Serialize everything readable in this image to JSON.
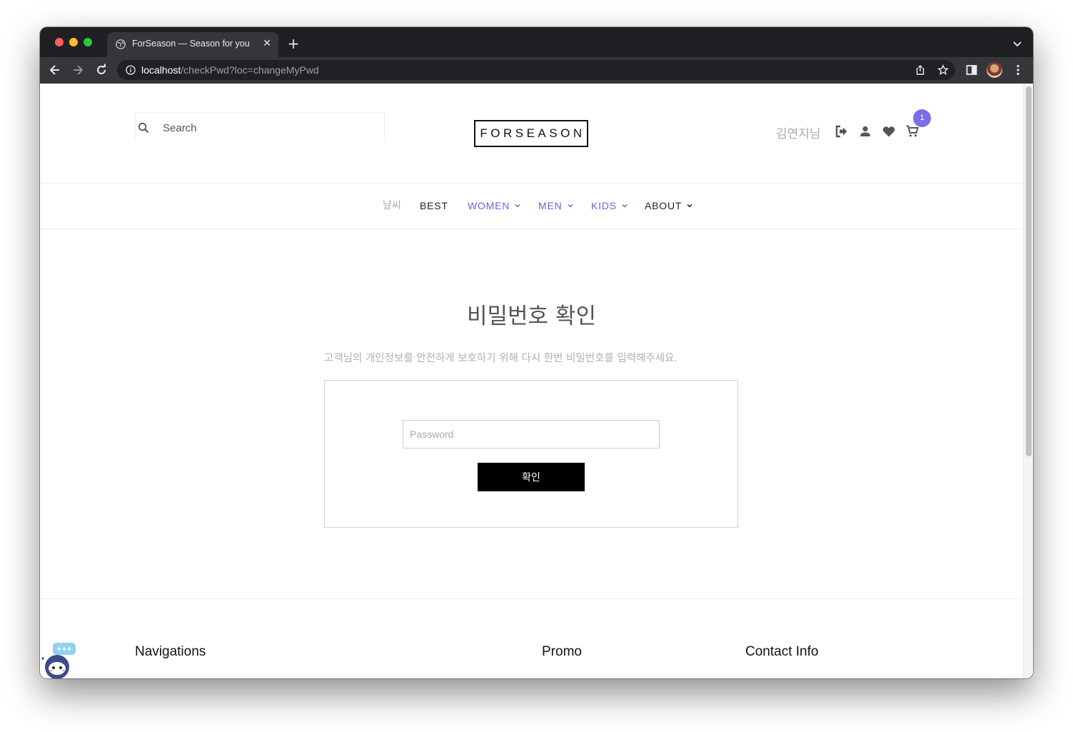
{
  "browser": {
    "tab_title": "ForSeason — Season for you",
    "url_host": "localhost",
    "url_path": "/checkPwd?loc=changeMyPwd"
  },
  "header": {
    "search_placeholder": "Search",
    "logo": "FORSEASON",
    "user_name": "김연지님",
    "cart_count": "1"
  },
  "nav": {
    "weather": "날씨",
    "items": [
      {
        "label": "BEST"
      },
      {
        "label": "WOMEN"
      },
      {
        "label": "MEN"
      },
      {
        "label": "KIDS"
      },
      {
        "label": "ABOUT"
      }
    ]
  },
  "main": {
    "title": "비밀번호 확인",
    "description": "고객님의 개인정보를 안전하게 보호하기 위해 다시 한번 비밀번호를 입력해주세요.",
    "password_placeholder": "Password",
    "confirm_label": "확인"
  },
  "footer": {
    "headings": [
      "Navigations",
      "Promo",
      "Contact Info"
    ]
  },
  "colors": {
    "accent": "#7b6ee6",
    "nav_accent": "#6c63d9",
    "button": "#000000"
  }
}
